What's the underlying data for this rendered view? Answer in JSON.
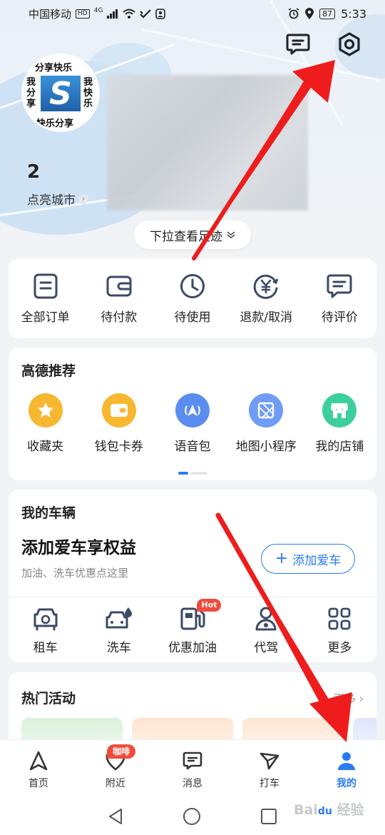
{
  "status_bar": {
    "carrier": "中国移动",
    "hd": "HD",
    "network": "4G",
    "battery": "87",
    "time": "5:33"
  },
  "profile": {
    "avatar_text": [
      "分享快乐",
      "我分享",
      "我快乐",
      "快乐分享"
    ],
    "city_count": "2",
    "city_label": "点亮城市",
    "pull_hint": "下拉查看足迹"
  },
  "orders": {
    "items": [
      {
        "label": "全部订单",
        "icon": "order-list-icon"
      },
      {
        "label": "待付款",
        "icon": "wallet-icon"
      },
      {
        "label": "待使用",
        "icon": "clock-icon"
      },
      {
        "label": "退款/取消",
        "icon": "refund-icon"
      },
      {
        "label": "待评价",
        "icon": "comment-icon"
      }
    ]
  },
  "recommend": {
    "title": "高德推荐",
    "items": [
      {
        "label": "收藏夹",
        "icon": "star-icon",
        "color": "#f7b731"
      },
      {
        "label": "钱包卡券",
        "icon": "wallet-card-icon",
        "color": "#f7b731"
      },
      {
        "label": "语音包",
        "icon": "voice-pack-icon",
        "color": "#5b8def"
      },
      {
        "label": "地图小程序",
        "icon": "mini-program-icon",
        "color": "#6f9cf5"
      },
      {
        "label": "我的店铺",
        "icon": "store-icon",
        "color": "#3ccf9c"
      }
    ]
  },
  "vehicle": {
    "title": "我的车辆",
    "headline": "添加爱车享权益",
    "subtitle": "加油、洗车优惠点这里",
    "add_button": "添加爱车",
    "services": [
      {
        "label": "租车",
        "icon": "rent-car-icon"
      },
      {
        "label": "洗车",
        "icon": "car-wash-icon"
      },
      {
        "label": "优惠加油",
        "icon": "fuel-icon",
        "badge": "Hot"
      },
      {
        "label": "代驾",
        "icon": "driver-icon"
      },
      {
        "label": "更多",
        "icon": "grid-icon"
      }
    ]
  },
  "activities": {
    "title": "热门活动",
    "more": "更多"
  },
  "tabbar": {
    "items": [
      {
        "label": "首页",
        "icon": "navigation-icon"
      },
      {
        "label": "附近",
        "icon": "heart-pin-icon",
        "badge": "咖啡"
      },
      {
        "label": "消息",
        "icon": "message-icon"
      },
      {
        "label": "打车",
        "icon": "taxi-icon"
      },
      {
        "label": "我的",
        "icon": "user-icon",
        "active": true
      }
    ]
  },
  "colors": {
    "accent": "#2a7bf6",
    "badge": "#f14b3b",
    "arrow": "#ee1c1c"
  }
}
